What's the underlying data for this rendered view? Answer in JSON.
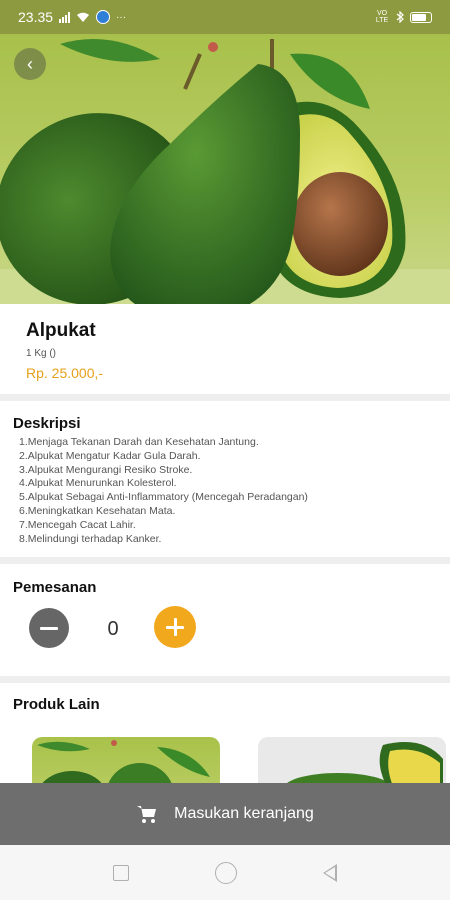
{
  "status_bar": {
    "time": "23.35",
    "icons": [
      "signal-icon",
      "wifi-icon",
      "browser-icon",
      "more-dots-icon",
      "volte-icon",
      "bluetooth-icon",
      "battery-icon"
    ],
    "more": "···",
    "network": "VO LTE"
  },
  "hero": {
    "image": "avocado-photo",
    "back_icon": "‹"
  },
  "product": {
    "name": "Alpukat",
    "unit": "1 Kg ()",
    "price": "Rp. 25.000,-"
  },
  "description": {
    "title": "Deskripsi",
    "items": [
      "1.Menjaga Tekanan Darah dan Kesehatan Jantung.",
      "2.Alpukat Mengatur Kadar Gula Darah.",
      "3.Alpukat Mengurangi Resiko Stroke.",
      "4.Alpukat Menurunkan Kolesterol.",
      "5.Alpukat Sebagai Anti-Inflammatory (Mencegah Peradangan)",
      "6.Meningkatkan Kesehatan Mata.",
      "7.Mencegah Cacat Lahir.",
      "8.Melindungi terhadap Kanker."
    ]
  },
  "order": {
    "title": "Pemesanan",
    "quantity": "0"
  },
  "other_products": {
    "title": "Produk Lain"
  },
  "cart": {
    "label": "Masukan keranjang"
  },
  "colors": {
    "accent": "#f2a81d",
    "price": "#e6a11a",
    "cart_bar": "#6e6e6e"
  }
}
